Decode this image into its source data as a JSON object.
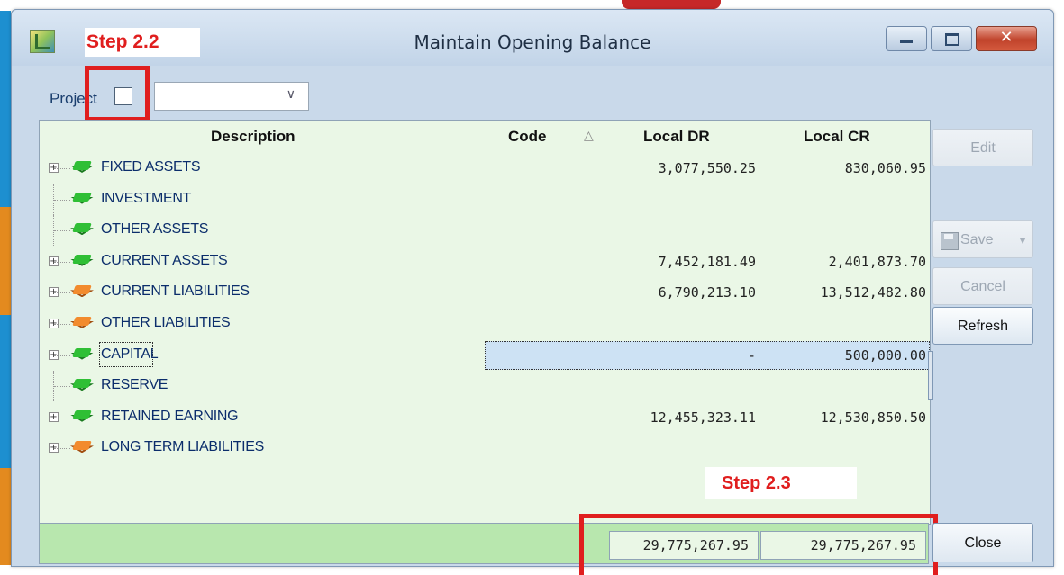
{
  "window": {
    "title": "Maintain Opening Balance",
    "close_glyph": "✕"
  },
  "annotations": {
    "step_22": "Step 2.2",
    "step_23": "Step 2.3"
  },
  "project": {
    "label": "Project",
    "checked": false,
    "selected_value": ""
  },
  "grid": {
    "headers": {
      "description": "Description",
      "code": "Code",
      "local_dr": "Local DR",
      "local_cr": "Local CR"
    },
    "rows": [
      {
        "description": "FIXED ASSETS",
        "expandable": true,
        "color": "green",
        "local_dr": "3,077,550.25",
        "local_cr": "830,060.95"
      },
      {
        "description": "INVESTMENT",
        "expandable": false,
        "color": "green",
        "local_dr": "",
        "local_cr": ""
      },
      {
        "description": "OTHER ASSETS",
        "expandable": false,
        "color": "green",
        "local_dr": "",
        "local_cr": ""
      },
      {
        "description": "CURRENT ASSETS",
        "expandable": true,
        "color": "green",
        "local_dr": "7,452,181.49",
        "local_cr": "2,401,873.70"
      },
      {
        "description": "CURRENT LIABILITIES",
        "expandable": true,
        "color": "orange",
        "local_dr": "6,790,213.10",
        "local_cr": "13,512,482.80"
      },
      {
        "description": "OTHER LIABILITIES",
        "expandable": true,
        "color": "orange",
        "local_dr": "",
        "local_cr": ""
      },
      {
        "description": "CAPITAL",
        "expandable": true,
        "color": "green",
        "local_dr": "-",
        "local_cr": "500,000.00",
        "selected": true
      },
      {
        "description": "RESERVE",
        "expandable": false,
        "color": "green",
        "local_dr": "",
        "local_cr": ""
      },
      {
        "description": "RETAINED EARNING",
        "expandable": true,
        "color": "green",
        "local_dr": "12,455,323.11",
        "local_cr": "12,530,850.50"
      },
      {
        "description": "LONG TERM LIABILITIES",
        "expandable": true,
        "color": "orange",
        "local_dr": "",
        "local_cr": ""
      }
    ],
    "totals": {
      "local_dr": "29,775,267.95",
      "local_cr": "29,775,267.95"
    }
  },
  "buttons": {
    "edit": "Edit",
    "save": "Save",
    "cancel": "Cancel",
    "refresh": "Refresh",
    "close": "Close"
  },
  "colors": {
    "annotation_red": "#e01e1e",
    "grid_bg": "#eaf7e6",
    "footer_bg": "#b8e7ae",
    "selection": "#cde2f4"
  }
}
